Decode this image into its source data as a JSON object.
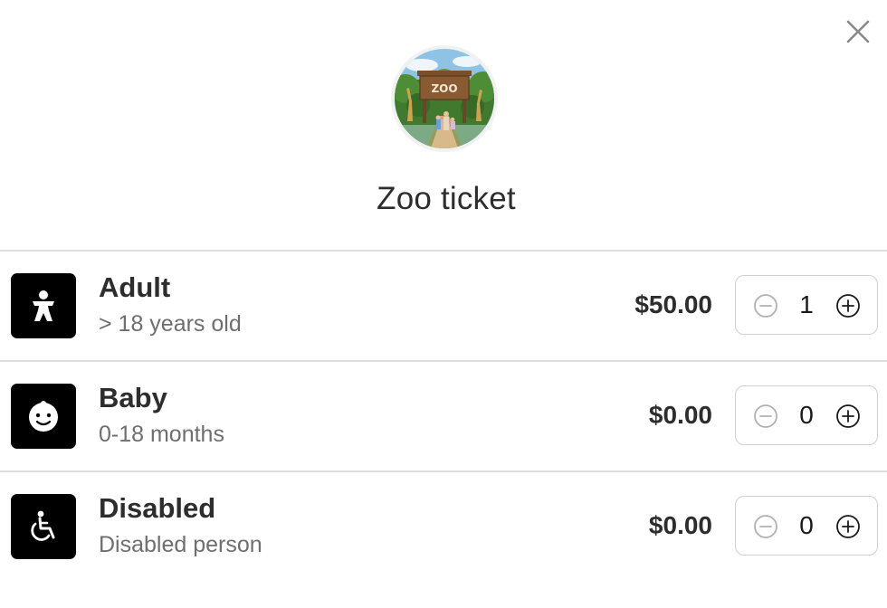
{
  "dialog": {
    "title": "Zoo ticket",
    "hero_sign_text": "ZOO",
    "close_icon": "close-icon"
  },
  "tickets": [
    {
      "name": "Adult",
      "description": "> 18 years old",
      "price": "$50.00",
      "quantity": "1",
      "icon": "person-icon"
    },
    {
      "name": "Baby",
      "description": "0-18 months",
      "price": "$0.00",
      "quantity": "0",
      "icon": "baby-face-icon"
    },
    {
      "name": "Disabled",
      "description": "Disabled person",
      "price": "$0.00",
      "quantity": "0",
      "icon": "wheelchair-icon"
    }
  ],
  "colors": {
    "icon_background": "#000000",
    "divider": "#dedede",
    "text_primary": "#2d2d2d",
    "text_secondary": "#6e6e6e",
    "minus_disabled": "#b0b0b0",
    "plus_active": "#1a1a1a"
  }
}
